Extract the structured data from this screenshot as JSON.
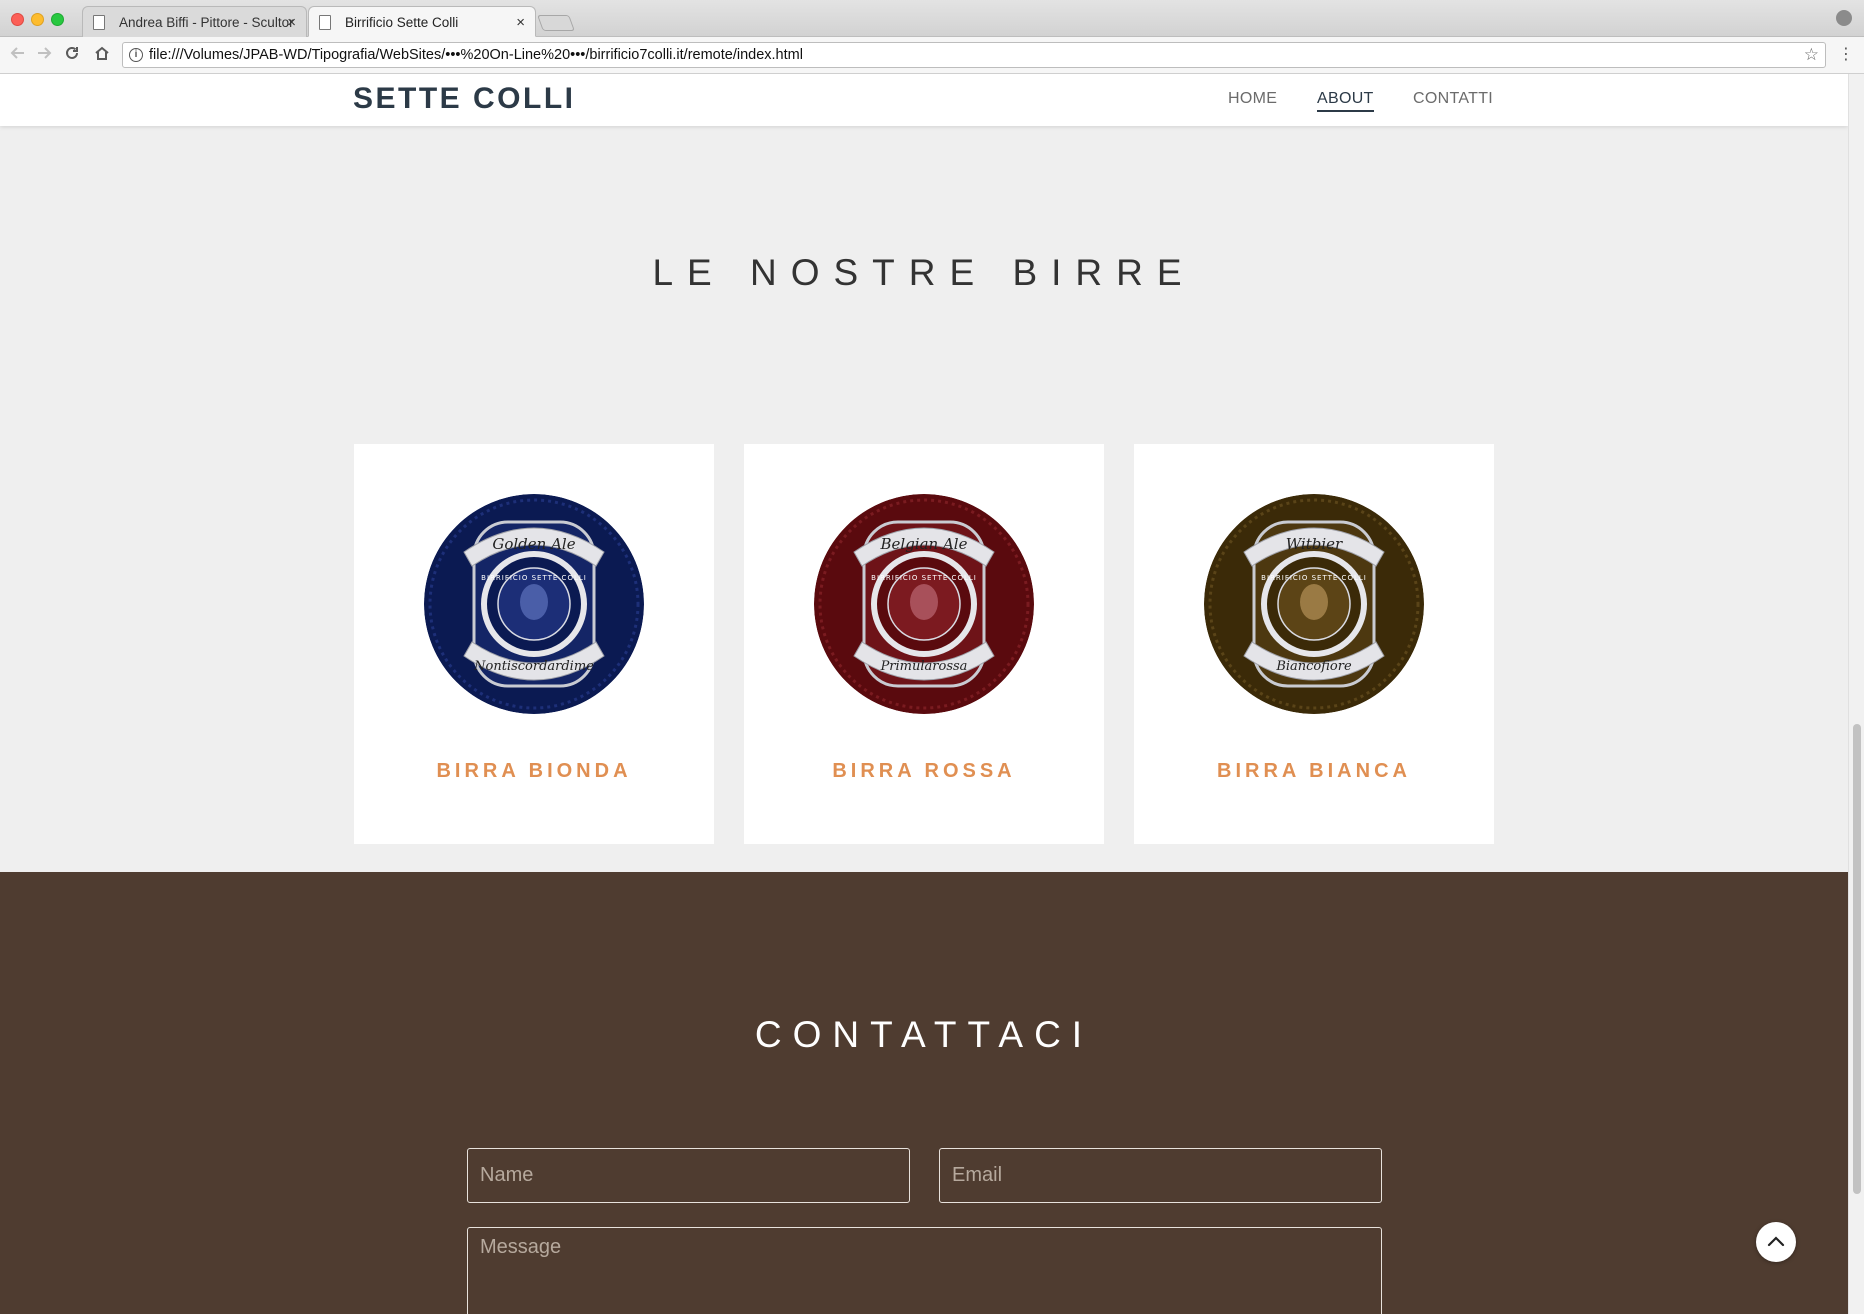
{
  "browser": {
    "tabs": [
      {
        "title": "Andrea Biffi - Pittore - Scultore",
        "active": false
      },
      {
        "title": "Birrificio Sette Colli",
        "active": true
      }
    ],
    "url": "file:///Volumes/JPAB-WD/Tipografia/WebSites/•••%20On-Line%20•••/birrificio7colli.it/remote/index.html",
    "close_glyph": "×"
  },
  "site": {
    "brand": "SETTE COLLI",
    "nav": [
      {
        "label": "HOME",
        "active": false
      },
      {
        "label": "ABOUT",
        "active": true
      },
      {
        "label": "CONTATTI",
        "active": false
      }
    ]
  },
  "beers_section": {
    "title": "LE NOSTRE BIRRE",
    "beers": [
      {
        "name": "BIRRA BIONDA",
        "style_script": "Golden Ale",
        "label_script": "Nontiscordardime",
        "badge": "BIRRIFICIO SETTE COLLI",
        "color": "#0b1a52"
      },
      {
        "name": "BIRRA ROSSA",
        "style_script": "Belgian Ale",
        "label_script": "Primularossa",
        "badge": "BIRRIFICIO SETTE COLLI",
        "color": "#5a0a0e"
      },
      {
        "name": "BIRRA BIANCA",
        "style_script": "Witbier",
        "label_script": "Biancofiore",
        "badge": "BIRRIFICIO SETTE COLLI",
        "color": "#3b2a08"
      }
    ]
  },
  "contact_section": {
    "title": "CONTATTACI",
    "name_placeholder": "Name",
    "email_placeholder": "Email",
    "message_placeholder": "Message"
  },
  "colors": {
    "brand_text": "#2c3a47",
    "accent_orange": "#e08f52",
    "contact_bg": "#4f3c30",
    "page_bg": "#efefef"
  }
}
